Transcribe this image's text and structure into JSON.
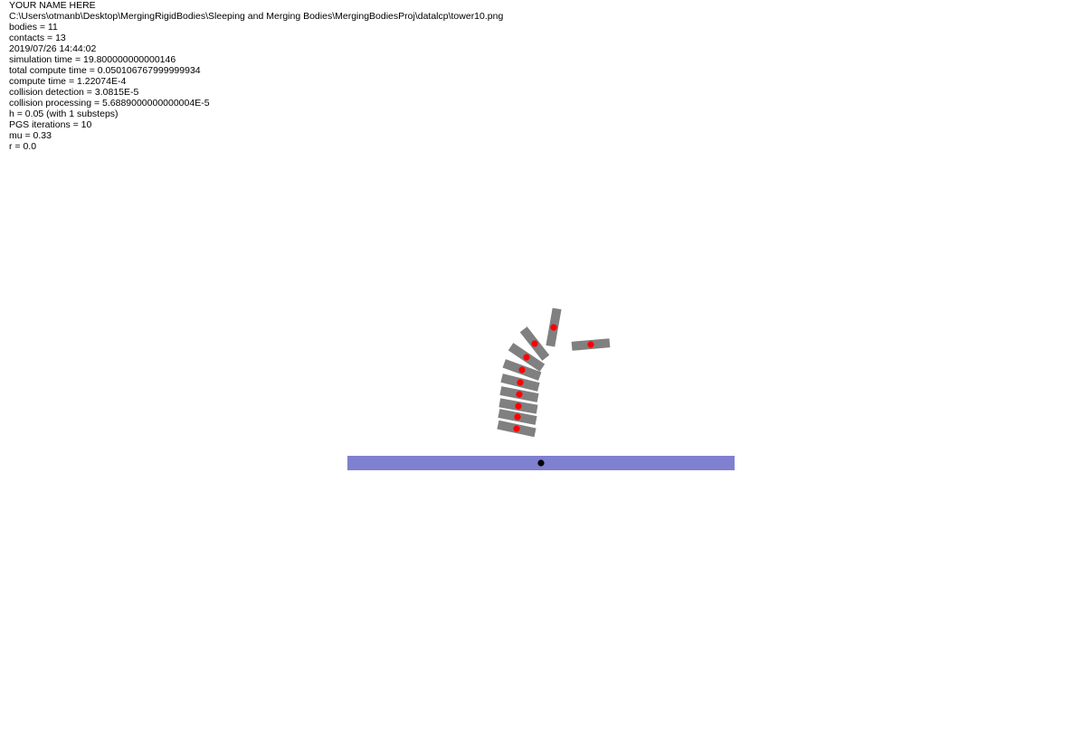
{
  "info": {
    "lines": [
      "YOUR NAME HERE",
      "C:\\Users\\otmanb\\Desktop\\MergingRigidBodies\\Sleeping and Merging Bodies\\MergingBodiesProj\\datalcp\\tower10.png",
      "bodies = 11",
      "contacts = 13",
      "2019/07/26 14:44:02",
      "simulation time = 19.800000000000146",
      "total compute time = 0.050106767999999934",
      "compute time = 1.22074E-4",
      "collision detection = 3.0815E-5",
      "collision processing = 5.6889000000000004E-5",
      "h = 0.05 (with 1 substeps)",
      "PGS iterations = 10",
      "mu = 0.33",
      "r = 0.0"
    ]
  },
  "scene": {
    "colors": {
      "background": "#ffffff",
      "ground": "#8080d0",
      "block": "#808080",
      "body_center": "#ff0000",
      "ground_center": "#000000",
      "text": "#000000"
    },
    "ground": {
      "pinned": true
    },
    "blocks": [
      {
        "id": 1,
        "pinned": false
      },
      {
        "id": 2,
        "pinned": false
      },
      {
        "id": 3,
        "pinned": false
      },
      {
        "id": 4,
        "pinned": false
      },
      {
        "id": 5,
        "pinned": false
      },
      {
        "id": 6,
        "pinned": false
      },
      {
        "id": 7,
        "pinned": false
      },
      {
        "id": 8,
        "pinned": false
      },
      {
        "id": 9,
        "pinned": false
      },
      {
        "id": 10,
        "pinned": false
      }
    ]
  }
}
